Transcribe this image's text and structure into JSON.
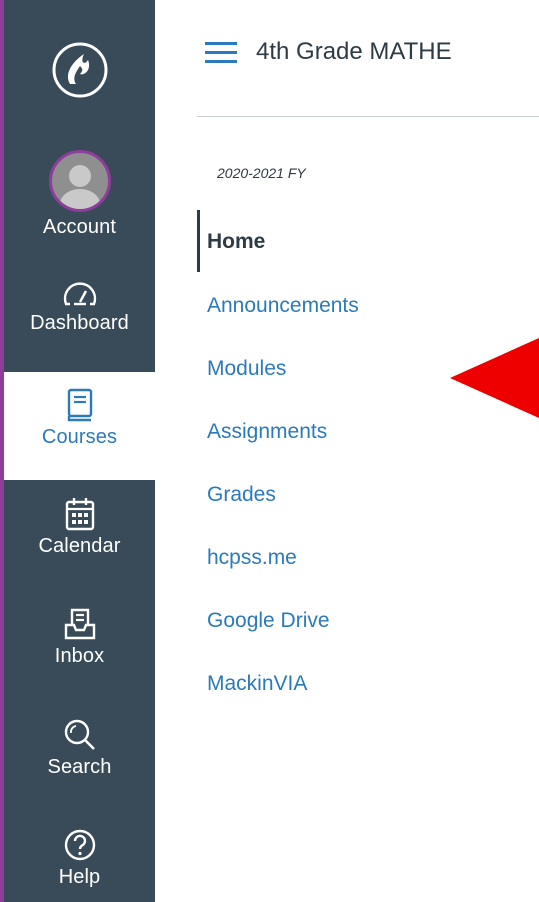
{
  "global_nav": {
    "account": "Account",
    "dashboard": "Dashboard",
    "courses": "Courses",
    "calendar": "Calendar",
    "inbox": "Inbox",
    "search": "Search",
    "help": "Help"
  },
  "course": {
    "title": "4th Grade MATHE",
    "term": "2020-2021 FY"
  },
  "course_nav": {
    "items": [
      {
        "label": "Home",
        "active": true
      },
      {
        "label": "Announcements"
      },
      {
        "label": "Modules"
      },
      {
        "label": "Assignments"
      },
      {
        "label": "Grades"
      },
      {
        "label": "hcpss.me"
      },
      {
        "label": "Google Drive"
      },
      {
        "label": "MackinVIA"
      }
    ]
  },
  "colors": {
    "nav_bg": "#394b58",
    "accent_purple": "#8e3d9a",
    "link_blue": "#2b7abc",
    "text_dark": "#2d3b45",
    "annotation_red": "#ee0000"
  },
  "icons": {
    "logo": "canvas-flame-logo-icon",
    "account": "user-avatar-icon",
    "dashboard": "speedometer-icon",
    "courses": "book-icon",
    "calendar": "calendar-icon",
    "inbox": "inbox-icon",
    "search": "magnifier-icon",
    "help": "question-circle-icon"
  }
}
